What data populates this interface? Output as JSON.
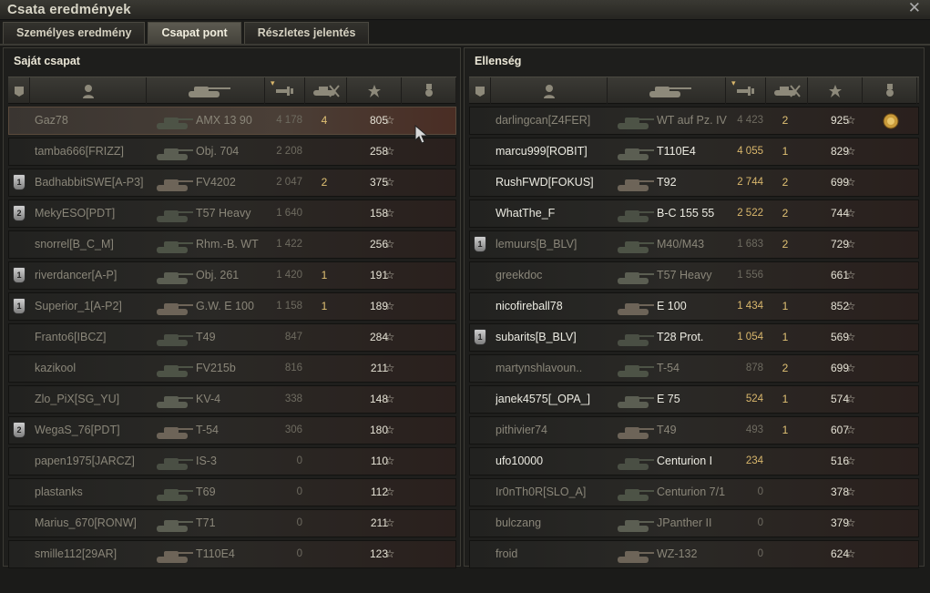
{
  "window": {
    "title": "Csata eredmények"
  },
  "tabs": [
    {
      "label": "Személyes eredmény",
      "active": false
    },
    {
      "label": "Csapat pont",
      "active": true
    },
    {
      "label": "Részletes jelentés",
      "active": false
    }
  ],
  "own": {
    "title": "Saját csapat",
    "players": [
      {
        "name": "Gaz78",
        "tank": "AMX 13 90",
        "damage": "4 178",
        "kills": "4",
        "xp": "805",
        "badge": "",
        "alive": false,
        "highlight": true
      },
      {
        "name": "tamba666[FRIZZ]",
        "tank": "Obj. 704",
        "damage": "2 208",
        "kills": "",
        "xp": "258",
        "badge": "",
        "alive": false
      },
      {
        "name": "BadhabbitSWE[A-P3]",
        "tank": "FV4202",
        "damage": "2 047",
        "kills": "2",
        "xp": "375",
        "badge": "1",
        "alive": false
      },
      {
        "name": "MekyESO[PDT]",
        "tank": "T57 Heavy",
        "damage": "1 640",
        "kills": "",
        "xp": "158",
        "badge": "2",
        "alive": false
      },
      {
        "name": "snorrel[B_C_M]",
        "tank": "Rhm.-B. WT",
        "damage": "1 422",
        "kills": "",
        "xp": "256",
        "badge": "",
        "alive": false
      },
      {
        "name": "riverdancer[A-P]",
        "tank": "Obj. 261",
        "damage": "1 420",
        "kills": "1",
        "xp": "191",
        "badge": "1",
        "alive": false
      },
      {
        "name": "Superior_1[A-P2]",
        "tank": "G.W. E 100",
        "damage": "1 158",
        "kills": "1",
        "xp": "189",
        "badge": "1",
        "alive": false
      },
      {
        "name": "Franto6[IBCZ]",
        "tank": "T49",
        "damage": "847",
        "kills": "",
        "xp": "284",
        "badge": "",
        "alive": false
      },
      {
        "name": "kazikool",
        "tank": "FV215b",
        "damage": "816",
        "kills": "",
        "xp": "211",
        "badge": "",
        "alive": false
      },
      {
        "name": "Zlo_PiX[SG_YU]",
        "tank": "KV-4",
        "damage": "338",
        "kills": "",
        "xp": "148",
        "badge": "",
        "alive": false
      },
      {
        "name": "WegaS_76[PDT]",
        "tank": "T-54",
        "damage": "306",
        "kills": "",
        "xp": "180",
        "badge": "2",
        "alive": false
      },
      {
        "name": "papen1975[JARCZ]",
        "tank": "IS-3",
        "damage": "0",
        "kills": "",
        "xp": "110",
        "badge": "",
        "alive": false
      },
      {
        "name": "plastanks",
        "tank": "T69",
        "damage": "0",
        "kills": "",
        "xp": "112",
        "badge": "",
        "alive": false
      },
      {
        "name": "Marius_670[RONW]",
        "tank": "T71",
        "damage": "0",
        "kills": "",
        "xp": "211",
        "badge": "",
        "alive": false
      },
      {
        "name": "smille112[29AR]",
        "tank": "T110E4",
        "damage": "0",
        "kills": "",
        "xp": "123",
        "badge": "",
        "alive": false
      }
    ]
  },
  "enemy": {
    "title": "Ellenség",
    "players": [
      {
        "name": "darlingcan[Z4FER]",
        "tank": "WT auf Pz. IV",
        "damage": "4 423",
        "kills": "2",
        "xp": "925",
        "badge": "",
        "alive": false,
        "medal": true
      },
      {
        "name": "marcu999[ROBIT]",
        "tank": "T110E4",
        "damage": "4 055",
        "kills": "1",
        "xp": "829",
        "badge": "",
        "alive": true
      },
      {
        "name": "RushFWD[FOKUS]",
        "tank": "T92",
        "damage": "2 744",
        "kills": "2",
        "xp": "699",
        "badge": "",
        "alive": true
      },
      {
        "name": "WhatThe_F",
        "tank": "B-C 155 55",
        "damage": "2 522",
        "kills": "2",
        "xp": "744",
        "badge": "",
        "alive": true
      },
      {
        "name": "lemuurs[B_BLV]",
        "tank": "M40/M43",
        "damage": "1 683",
        "kills": "2",
        "xp": "729",
        "badge": "1",
        "alive": false
      },
      {
        "name": "greekdoc",
        "tank": "T57 Heavy",
        "damage": "1 556",
        "kills": "",
        "xp": "661",
        "badge": "",
        "alive": false
      },
      {
        "name": "nicofireball78",
        "tank": "E 100",
        "damage": "1 434",
        "kills": "1",
        "xp": "852",
        "badge": "",
        "alive": true
      },
      {
        "name": "subarits[B_BLV]",
        "tank": "T28 Prot.",
        "damage": "1 054",
        "kills": "1",
        "xp": "569",
        "badge": "1",
        "alive": true
      },
      {
        "name": "martynshlavoun..",
        "tank": "T-54",
        "damage": "878",
        "kills": "2",
        "xp": "699",
        "badge": "",
        "alive": false
      },
      {
        "name": "janek4575[_OPA_]",
        "tank": "E 75",
        "damage": "524",
        "kills": "1",
        "xp": "574",
        "badge": "",
        "alive": true
      },
      {
        "name": "pithivier74",
        "tank": "T49",
        "damage": "493",
        "kills": "1",
        "xp": "607",
        "badge": "",
        "alive": false
      },
      {
        "name": "ufo10000",
        "tank": "Centurion I",
        "damage": "234",
        "kills": "",
        "xp": "516",
        "badge": "",
        "alive": true
      },
      {
        "name": "Ir0nTh0R[SLO_A]",
        "tank": "Centurion 7/1",
        "damage": "0",
        "kills": "",
        "xp": "378",
        "badge": "",
        "alive": false
      },
      {
        "name": "bulczang",
        "tank": "JPanther II",
        "damage": "0",
        "kills": "",
        "xp": "379",
        "badge": "",
        "alive": false
      },
      {
        "name": "froid",
        "tank": "WZ-132",
        "damage": "0",
        "kills": "",
        "xp": "624",
        "badge": "",
        "alive": false
      }
    ]
  },
  "icons": {
    "star": "☆",
    "close": "✕"
  },
  "colors": {
    "accent_damage": "#d9b76c",
    "alive_text": "#ecebe2",
    "dead_text": "#8a8679"
  }
}
